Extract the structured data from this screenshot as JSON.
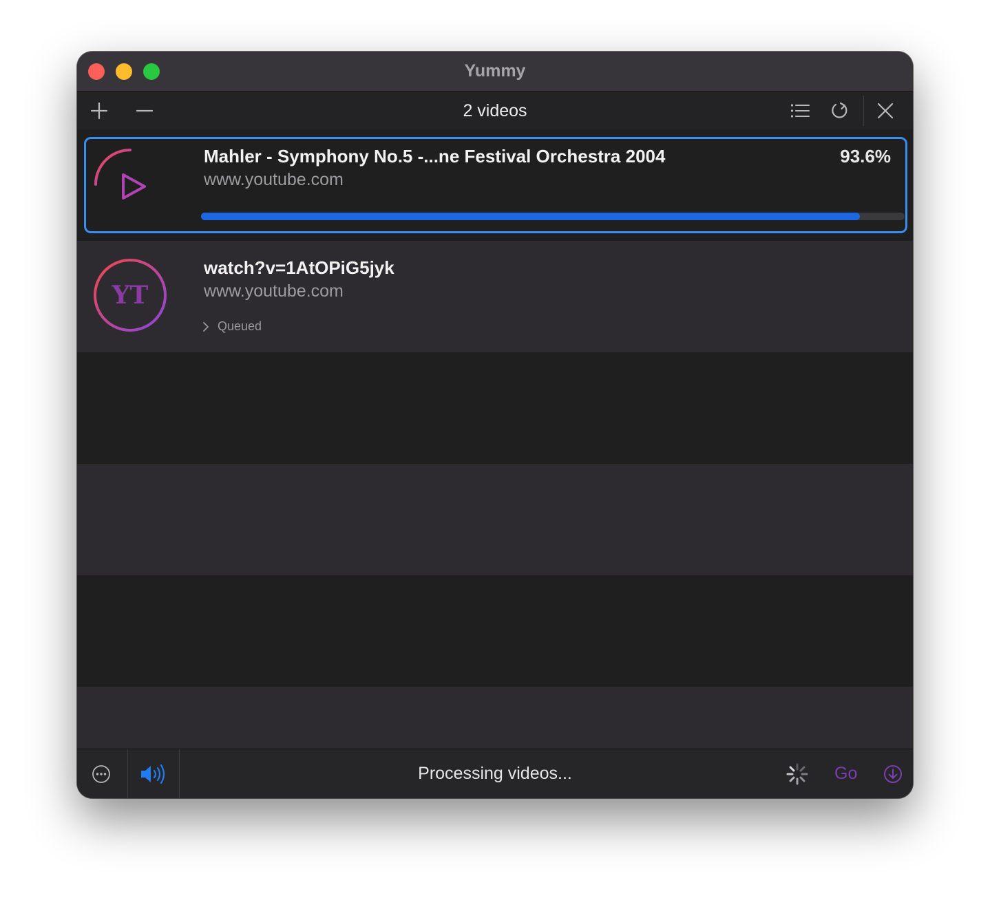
{
  "window": {
    "title": "Yummy"
  },
  "toolbar": {
    "count_label": "2 videos",
    "icons": [
      "plus-icon",
      "minus-icon",
      "list-icon",
      "refresh-icon",
      "close-icon"
    ]
  },
  "items": [
    {
      "title": "Mahler - Symphony No.5 -...ne Festival Orchestra 2004",
      "host": "www.youtube.com",
      "percent_label": "93.6%",
      "progress_fraction": 0.936,
      "selected": true
    },
    {
      "title": "watch?v=1AtOPiG5jyk",
      "host": "www.youtube.com",
      "status": "Queued",
      "thumb_text": "YT"
    }
  ],
  "bottombar": {
    "status": "Processing videos...",
    "go_label": "Go"
  },
  "colors": {
    "accent_blue": "#1d67e0",
    "selection_border": "#3b8ef0",
    "go_purple": "#7a3fb1"
  }
}
